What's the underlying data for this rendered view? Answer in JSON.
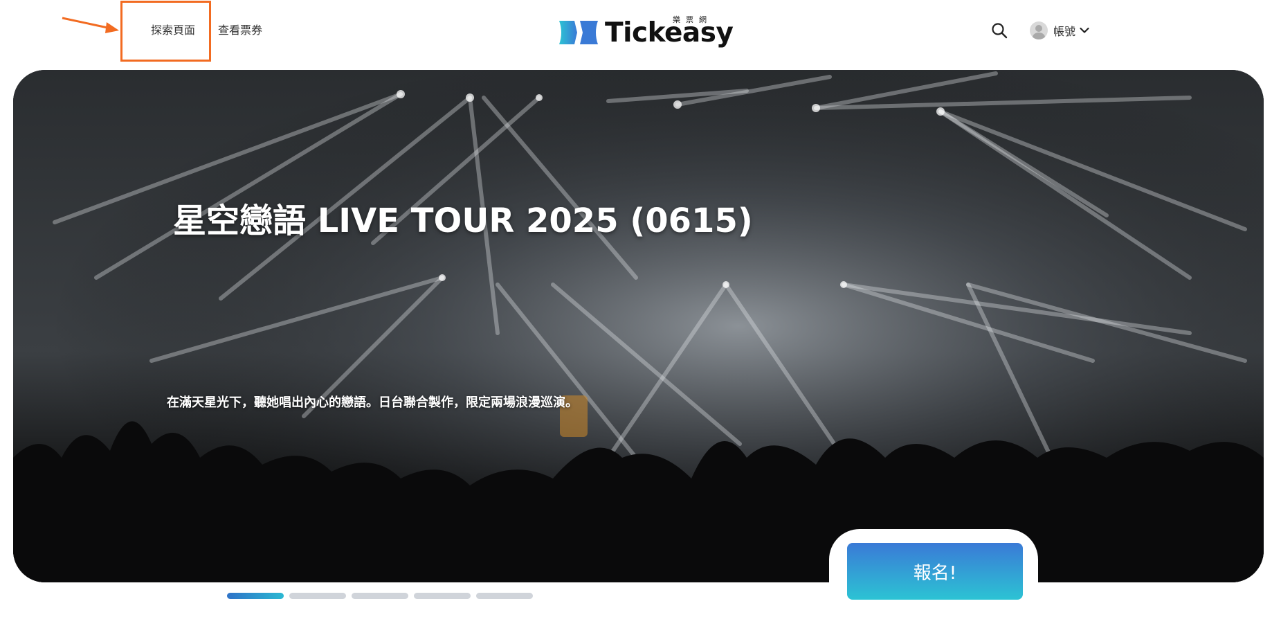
{
  "header": {
    "nav": [
      {
        "label": "探索頁面"
      },
      {
        "label": "查看票券"
      }
    ],
    "logo": {
      "wordmark": "Tickeasy",
      "subtitle": "樂票網"
    },
    "account_label": "帳號",
    "annotation_color": "#f26b21"
  },
  "hero": {
    "title": "星空戀語 LIVE TOUR 2025 (0615)",
    "description": "在滿天星光下，聽她唱出內心的戀語。日台聯合製作，限定兩場浪漫巡演。",
    "cta_label": "報名!"
  },
  "carousel": {
    "count": 5,
    "active_index": 0
  },
  "colors": {
    "accent_blue": "#3a7ad6",
    "accent_teal": "#2cc3d4",
    "dot_inactive": "#d0d4da"
  }
}
